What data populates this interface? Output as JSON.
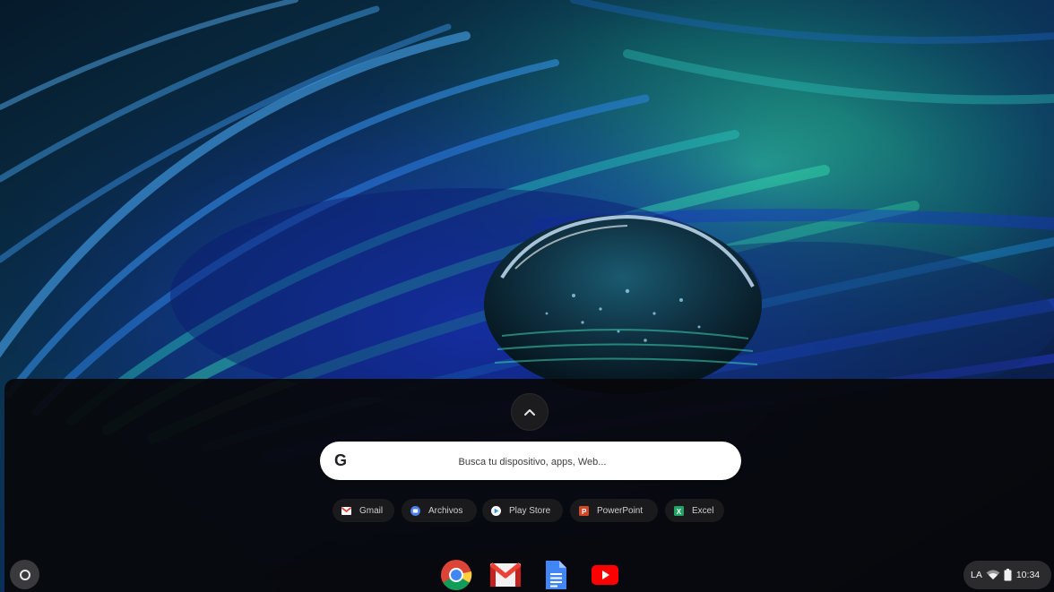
{
  "desktop": {
    "wallpaper": "peacock-feather-water-droplet"
  },
  "launcher": {
    "expand_icon": "chevron-up-icon",
    "search": {
      "placeholder": "Busca tu dispositivo, apps, Web...",
      "icon": "google-g-icon"
    },
    "suggested_apps": [
      {
        "label": "Gmail",
        "icon": "gmail-icon",
        "color": "#e04535"
      },
      {
        "label": "Archivos",
        "icon": "files-icon",
        "color": "#4a7fe8"
      },
      {
        "label": "Play Store",
        "icon": "play-store-icon",
        "color": "#30b7a8"
      },
      {
        "label": "PowerPoint",
        "icon": "powerpoint-icon",
        "color": "#d24726"
      },
      {
        "label": "Excel",
        "icon": "excel-icon",
        "color": "#21a366"
      }
    ]
  },
  "shelf": {
    "launcher_icon": "launcher-circle-icon",
    "pinned_apps": [
      {
        "name": "Chrome",
        "icon": "chrome-icon"
      },
      {
        "name": "Gmail",
        "icon": "gmail-icon"
      },
      {
        "name": "Docs",
        "icon": "docs-icon"
      },
      {
        "name": "YouTube",
        "icon": "youtube-icon"
      }
    ],
    "status": {
      "keyboard_layout": "LA",
      "wifi_icon": "wifi-icon",
      "battery_icon": "battery-icon",
      "time": "10:34"
    }
  }
}
